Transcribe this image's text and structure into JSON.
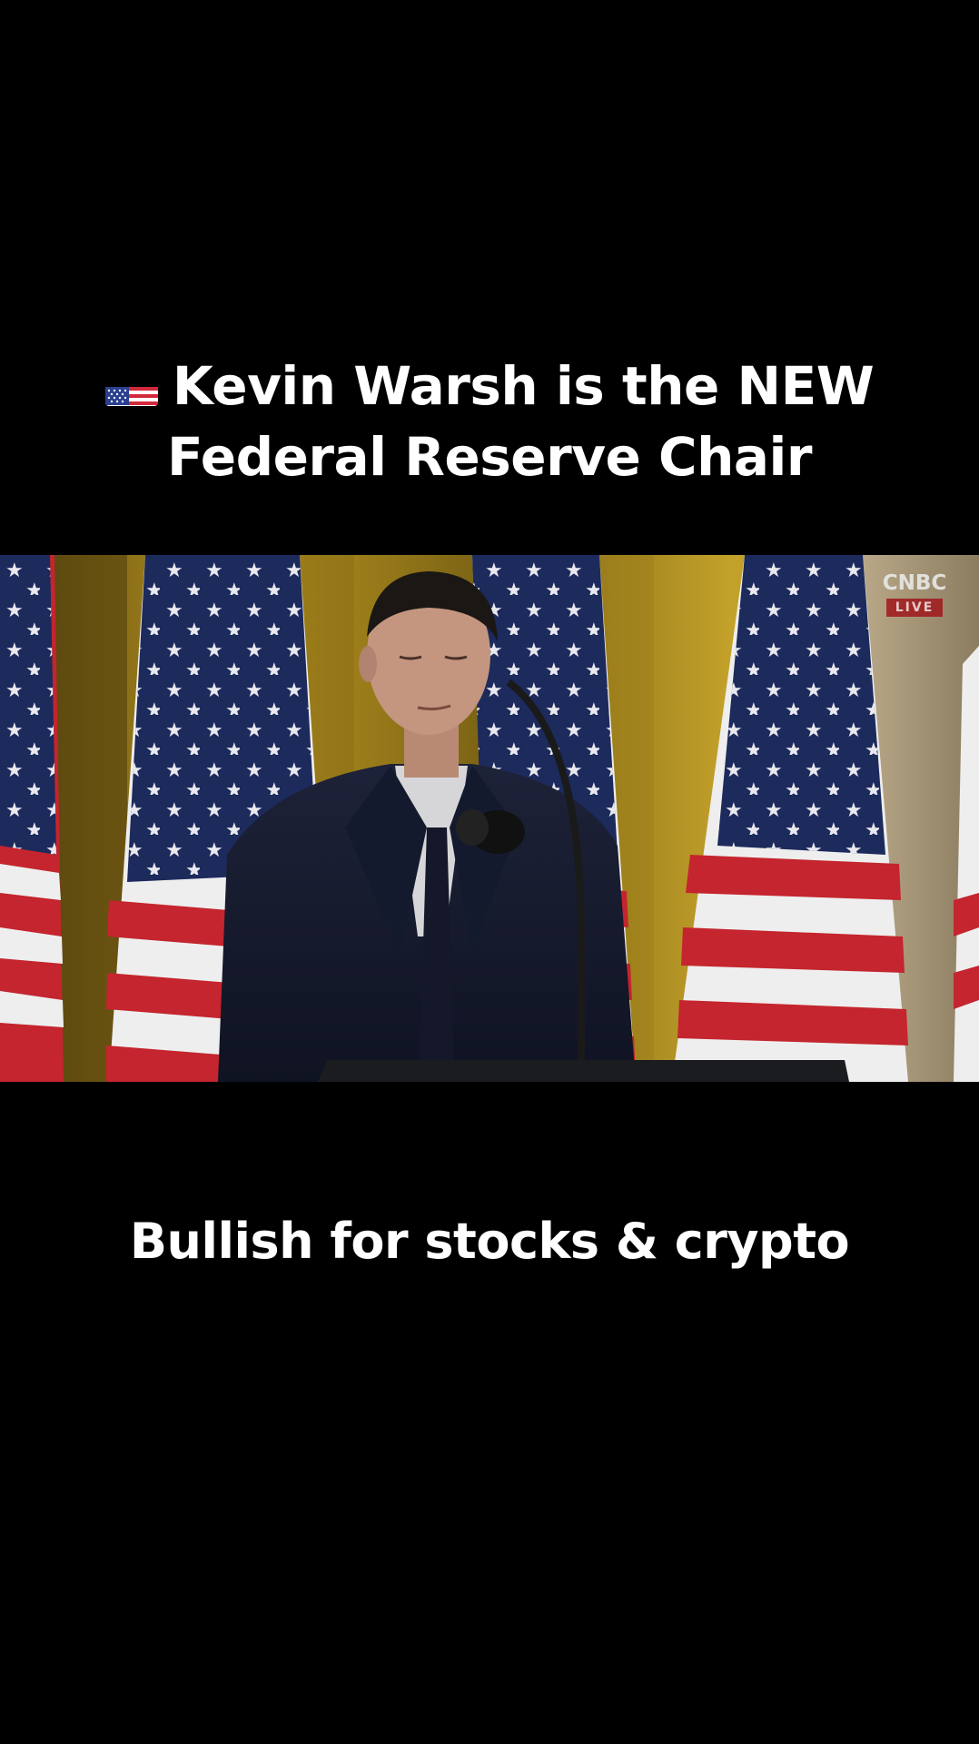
{
  "headline": {
    "flag_icon": "us-flag-emoji",
    "line1": "Kevin Warsh is the NEW",
    "line2": "Federal Reserve Chair"
  },
  "video": {
    "network": "CNBC",
    "live_badge": "LIVE"
  },
  "caption": "Bullish for stocks & crypto",
  "colors": {
    "background": "#000000",
    "text": "#ffffff",
    "flag_blue": "#1c2a5c",
    "flag_red": "#c4252e",
    "curtain_gold": "#b89420",
    "live_red": "#a0161c"
  }
}
